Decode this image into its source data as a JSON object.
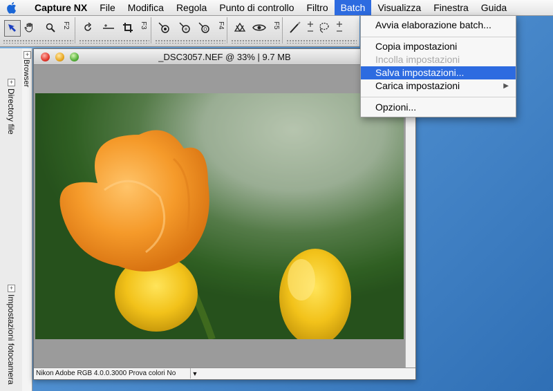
{
  "menubar": {
    "app_name": "Capture NX",
    "items": [
      "File",
      "Modifica",
      "Regola",
      "Punto di controllo",
      "Filtro",
      "Batch",
      "Visualizza",
      "Finestra",
      "Guida"
    ],
    "active": "Batch"
  },
  "toolbar": {
    "labels": {
      "f2": "F2",
      "f3": "F3",
      "f4": "F4",
      "f5": "F5"
    }
  },
  "batch_menu": {
    "items": [
      {
        "label": "Avvia elaborazione batch...",
        "state": "enabled"
      },
      {
        "label": "Copia impostazioni",
        "state": "enabled"
      },
      {
        "label": "Incolla impostazioni",
        "state": "disabled"
      },
      {
        "label": "Salva impostazioni...",
        "state": "highlighted"
      },
      {
        "label": "Carica impostazioni",
        "state": "submenu"
      },
      {
        "label": "Opzioni...",
        "state": "enabled"
      }
    ],
    "submenu_glyph": "▶"
  },
  "palette": {
    "browser": "Browser",
    "directory": "Directory file",
    "settings": "Impostazioni fotocamera"
  },
  "document": {
    "title": "_DSC3057.NEF @ 33% | 9.7 MB",
    "status": "Nikon Adobe RGB 4.0.0.3000  Prova colori No",
    "status_arrow": "▼"
  },
  "colors": {
    "menu_highlight": "#2d6be0",
    "tulip_orange": "#f59a2a",
    "tulip_yellow": "#f2c21a",
    "background_green": "#2f5a24"
  }
}
